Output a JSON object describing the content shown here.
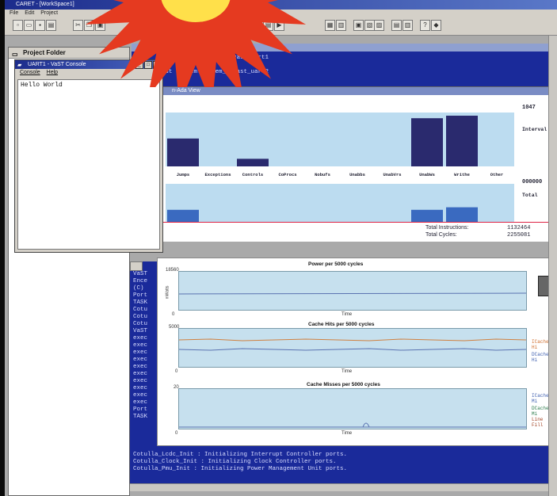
{
  "app": {
    "title": "CARET - [WorkSpace1]",
    "menu": [
      "File",
      "Edit",
      "Project"
    ]
  },
  "project_folder": {
    "title": "Project Folder"
  },
  "console": {
    "title": "UART1 - VaST Console",
    "menu": [
      "Console",
      "Help"
    ],
    "text": "Hello World"
  },
  "top_log": {
    "lines": [
      "est system.system_1.vast_uart1",
      "ide",
      "est system.system_1.vast_uart2"
    ]
  },
  "bottom_log": {
    "left_lines": [
      "VaST",
      "Ence",
      "(C)",
      "",
      "Port",
      "TASK",
      "Cotu",
      "Cotu",
      "Cotu",
      "VaST",
      "exec",
      "exec",
      "exec",
      "exec",
      "exec",
      "exec",
      "exec",
      "exec",
      "exec",
      "exec",
      "Port",
      "TASK"
    ],
    "lines": [
      "Cotulla_Lcdc_Init : Initializing Interrupt Controller ports.",
      "Cotulla_Clock_Init : Initializing Clock Controller ports.",
      "Cotulla_Pmu_Init : Initializing Power Management Unit ports."
    ]
  },
  "profile": {
    "title_suffix": "n-Ada View",
    "interval_value": "1047",
    "interval_label": "Interval",
    "total_value": "000000",
    "total_label": "Total",
    "categories": [
      "Jumps",
      "Exceptions",
      "Controls",
      "CoProcs",
      "Nobufs",
      "Unabbs",
      "UnabVrs",
      "UnabWs",
      "Writhe",
      "Other"
    ],
    "interval_values": [
      0.55,
      0,
      0.15,
      0,
      0,
      0,
      0,
      0.95,
      1.0,
      0
    ],
    "total_values": [
      0.55,
      0,
      0.08,
      0,
      0,
      0,
      0,
      0.55,
      0.6,
      0
    ],
    "total_instructions_label": "Total Instructions:",
    "total_instructions": "1132464",
    "total_cycles_label": "Total Cycles:",
    "total_cycles": "2255081"
  },
  "graphs": [
    {
      "title": "Power per 5000 cycles",
      "ymax": "18560",
      "ymin": "0",
      "ylabel": "mWatts",
      "xlabel": "Time",
      "legend": []
    },
    {
      "title": "Cache Hits per 5000 cycles",
      "ymax": "5000",
      "ymin": "0",
      "xlabel": "Time",
      "legend": [
        "ICache Hi",
        "DCache Hi"
      ]
    },
    {
      "title": "Cache Misses per 5000 cycles",
      "ymax": "20",
      "ymin": "0",
      "xlabel": "Time",
      "legend": [
        "ICache Mi",
        "DCache Mi",
        "Line Fill"
      ]
    }
  ],
  "colors": {
    "bar_interval": "#2a2a6e",
    "bar_total": "#3a6ac0",
    "chart_bg": "#bcdcf0",
    "log_bg": "#1a2a9a",
    "burst": "#e53a20",
    "burst_core": "#ffe04a"
  }
}
